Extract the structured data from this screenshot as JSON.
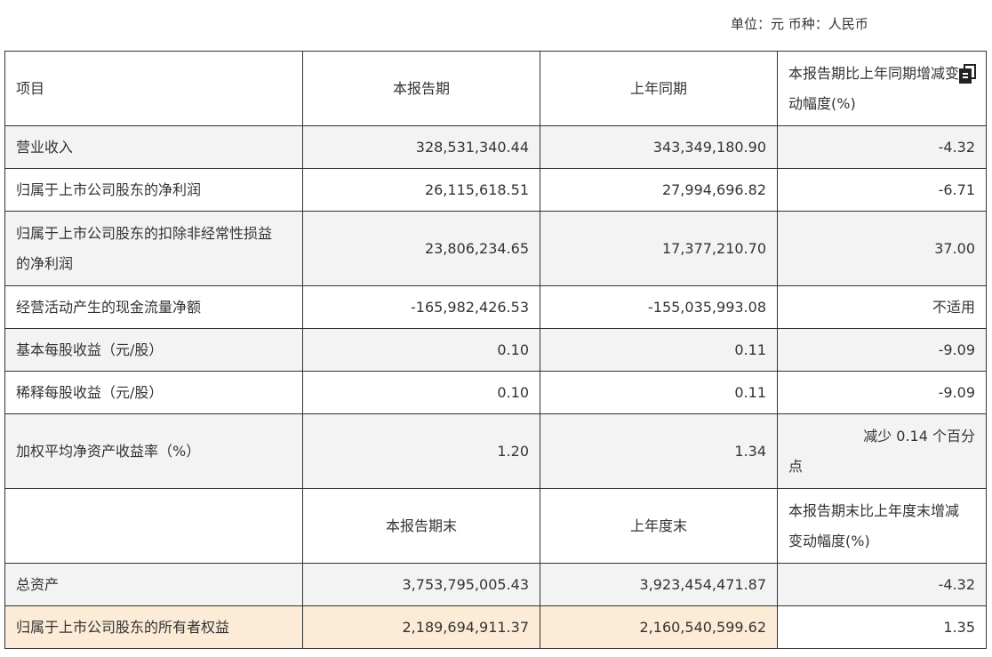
{
  "unit_line": "单位：元 币种：人民币",
  "header": {
    "col_item": "项目",
    "col_current": "本报告期",
    "col_prior": "上年同期",
    "col_change_line1": "本报告期比上年同期增减变",
    "col_change_line2": "动幅度(%)",
    "copy_icon": "copy-icon"
  },
  "rows": [
    {
      "label": "营业收入",
      "current": "328,531,340.44",
      "prior": "343,349,180.90",
      "change": "-4.32"
    },
    {
      "label": "归属于上市公司股东的净利润",
      "current": "26,115,618.51",
      "prior": "27,994,696.82",
      "change": "-6.71"
    },
    {
      "label_line1": "归属于上市公司股东的扣除非经常性损益",
      "label_line2": "的净利润",
      "current": "23,806,234.65",
      "prior": "17,377,210.70",
      "change": "37.00"
    },
    {
      "label": "经营活动产生的现金流量净额",
      "current": "-165,982,426.53",
      "prior": "-155,035,993.08",
      "change": "不适用"
    },
    {
      "label": "基本每股收益（元/股）",
      "current": "0.10",
      "prior": "0.11",
      "change": "-9.09"
    },
    {
      "label": "稀释每股收益（元/股）",
      "current": "0.10",
      "prior": "0.11",
      "change": "-9.09"
    },
    {
      "label": "加权平均净资产收益率（%）",
      "current": "1.20",
      "prior": "1.34",
      "change_line1": "减少 0.14 个百分",
      "change_line2": "点"
    }
  ],
  "subheader": {
    "col_current": "本报告期末",
    "col_prior": "上年度末",
    "col_change_line1": "本报告期末比上年度末增减",
    "col_change_line2": "变动幅度(%)"
  },
  "rows2": [
    {
      "label": "总资产",
      "current": "3,753,795,005.43",
      "prior": "3,923,454,471.87",
      "change": "-4.32"
    },
    {
      "label": "归属于上市公司股东的所有者权益",
      "current": "2,189,694,911.37",
      "prior": "2,160,540,599.62",
      "change": "1.35"
    }
  ]
}
